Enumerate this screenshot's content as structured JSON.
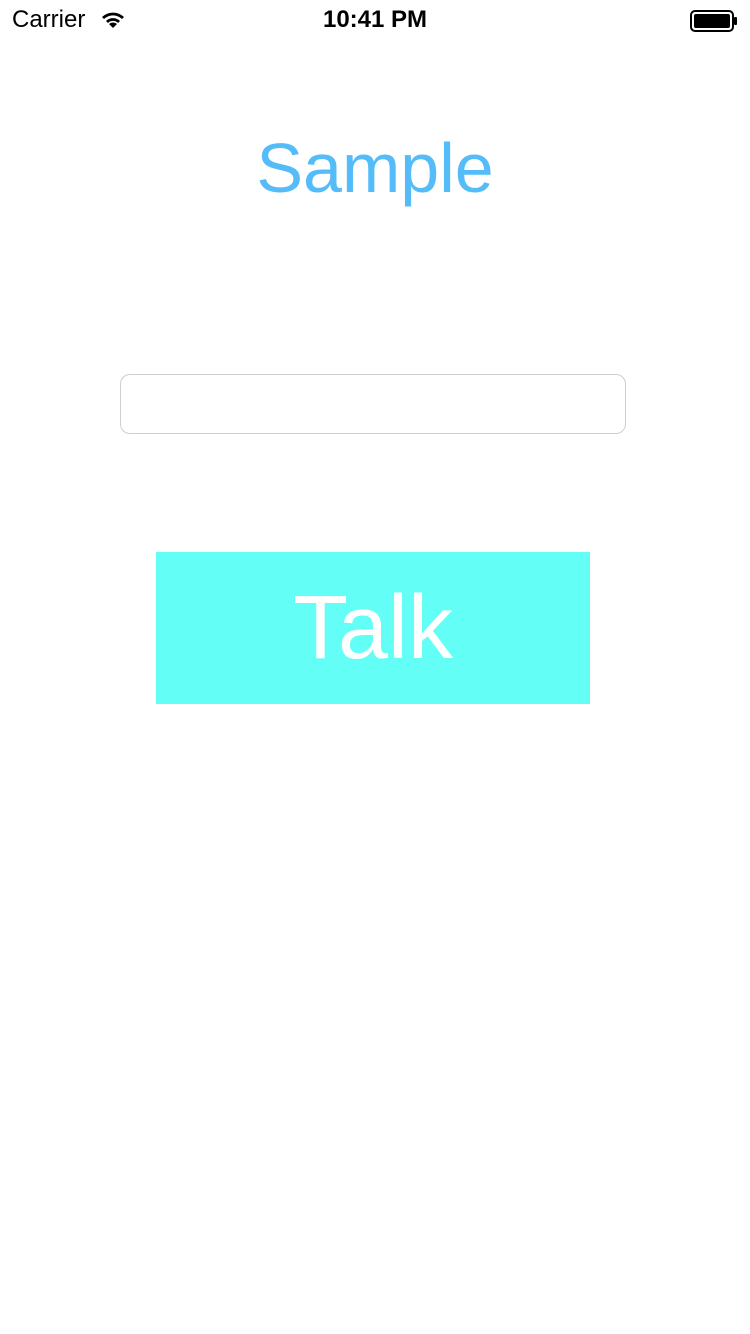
{
  "status_bar": {
    "carrier": "Carrier",
    "time": "10:41 PM",
    "wifi_icon": "wifi-icon",
    "battery_icon": "battery-icon"
  },
  "main": {
    "title": "Sample",
    "input": {
      "value": "",
      "placeholder": ""
    },
    "talk_button": {
      "label": "Talk"
    }
  },
  "colors": {
    "title": "#54bcf8",
    "talk_button_bg": "#63fff7",
    "talk_button_text": "#ffffff",
    "input_border": "#cfcfcf",
    "background": "#ffffff"
  }
}
